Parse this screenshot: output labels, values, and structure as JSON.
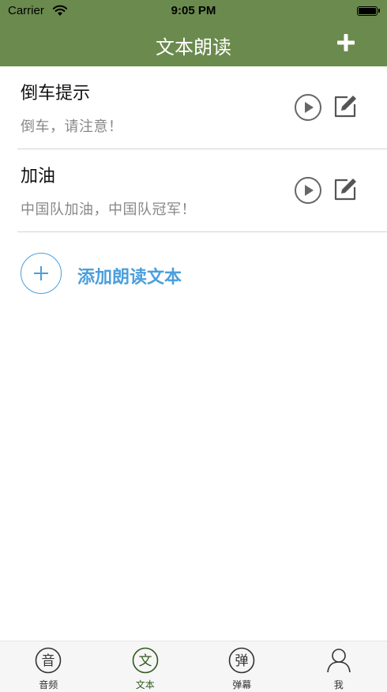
{
  "status": {
    "carrier": "Carrier",
    "time": "9:05 PM"
  },
  "nav": {
    "title": "文本朗读",
    "add_icon": "plus-icon"
  },
  "items": [
    {
      "title": "倒车提示",
      "subtitle": "倒车，请注意！"
    },
    {
      "title": "加油",
      "subtitle": "中国队加油，中国队冠军！"
    }
  ],
  "add": {
    "label": "添加朗读文本",
    "icon": "plus-circle-icon"
  },
  "tabs": [
    {
      "label": "音频",
      "glyph": "音",
      "icon": "audio-tab-icon"
    },
    {
      "label": "文本",
      "glyph": "文",
      "icon": "text-tab-icon",
      "active": true
    },
    {
      "label": "弹幕",
      "glyph": "弹",
      "icon": "danmaku-tab-icon"
    },
    {
      "label": "我",
      "icon": "person-icon"
    }
  ],
  "colors": {
    "nav_bg": "#6b8a4e",
    "accent_blue": "#4a9fdc",
    "active_tab": "#2f5a1e"
  }
}
